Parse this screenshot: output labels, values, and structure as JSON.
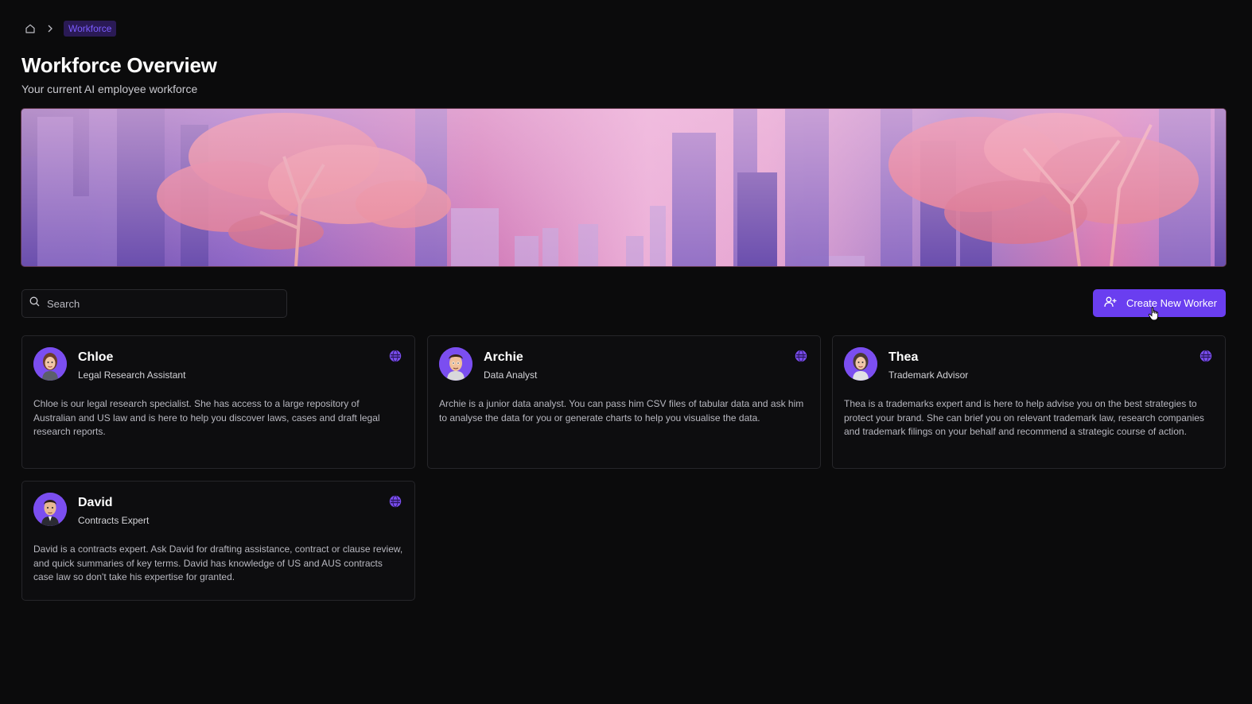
{
  "breadcrumb": {
    "home_icon": "home-icon",
    "current": "Workforce"
  },
  "header": {
    "title": "Workforce Overview",
    "subtitle": "Your current AI employee workforce"
  },
  "search": {
    "placeholder": "Search",
    "value": ""
  },
  "actions": {
    "create_label": "Create New Worker",
    "create_icon": "user-plus-icon"
  },
  "colors": {
    "accent": "#6a3ef0",
    "background": "#0b0b0c",
    "card_border": "#26262a",
    "avatar_bg": "#7b4ef0"
  },
  "workers": [
    {
      "name": "Chloe",
      "role": "Legal Research Assistant",
      "description": "Chloe is our legal research specialist. She has access to a large repository of Australian and US law and is here to help you discover laws, cases and draft legal research reports."
    },
    {
      "name": "Archie",
      "role": "Data Analyst",
      "description": "Archie is a junior data analyst. You can pass him CSV files of tabular data and ask him to analyse the data for you or generate charts to help you visualise the data."
    },
    {
      "name": "Thea",
      "role": "Trademark Advisor",
      "description": "Thea is a trademarks expert and is here to help advise you on the best strategies to protect your brand. She can brief you on relevant trademark law, research companies and trademark filings on your behalf and recommend a strategic course of action."
    },
    {
      "name": "David",
      "role": "Contracts Expert",
      "description": "David is a contracts expert. Ask David for drafting assistance, contract or clause review, and quick summaries of key terms. David has knowledge of US and AUS contracts case law so don't take his expertise for granted."
    }
  ]
}
